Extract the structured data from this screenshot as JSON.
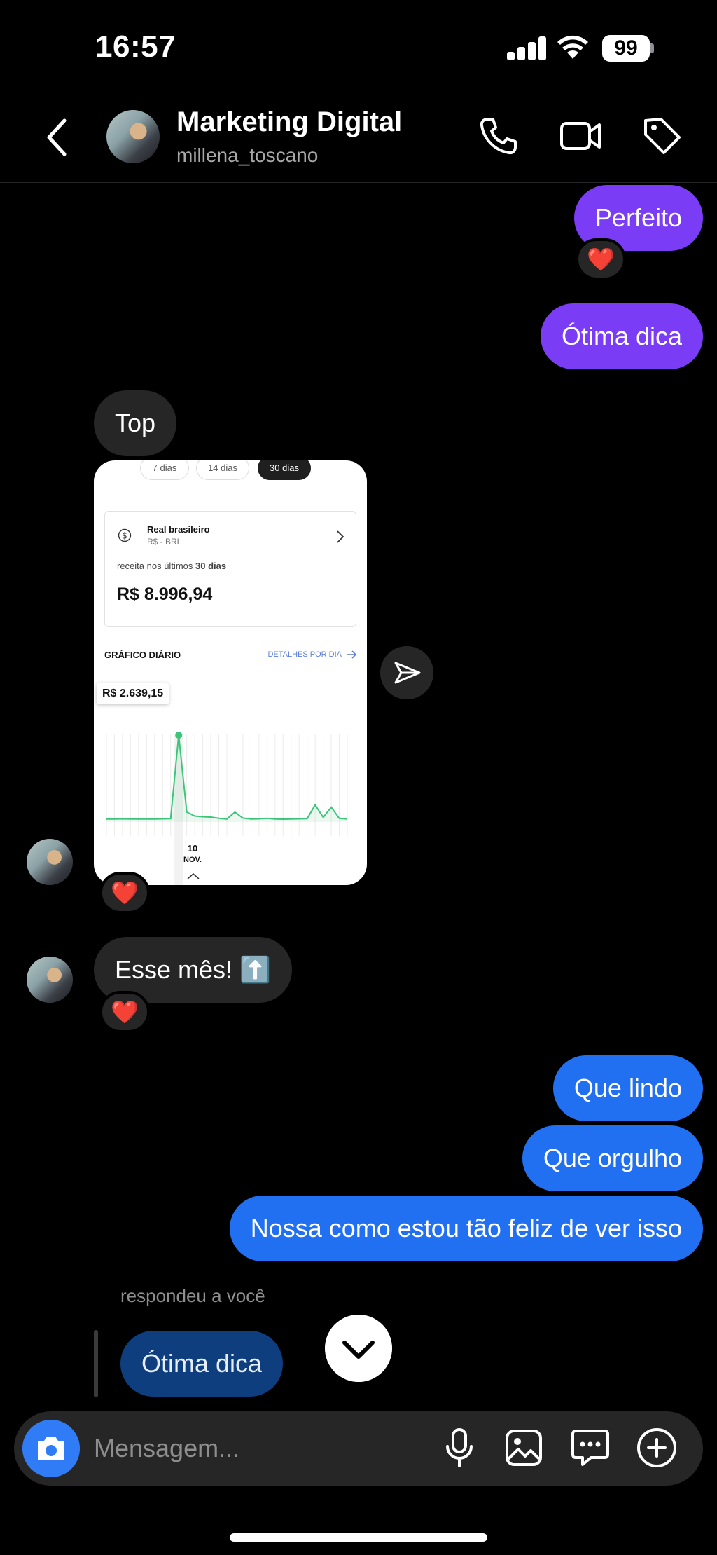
{
  "status": {
    "time": "16:57",
    "battery": "99"
  },
  "header": {
    "title": "Marketing Digital",
    "username": "millena_toscano"
  },
  "messages": {
    "perfeito": "Perfeito",
    "otima_dica": "Ótima dica",
    "top": "Top",
    "esse_mes": "Esse mês! ⬆️",
    "que_lindo": "Que lindo",
    "que_orgulho": "Que orgulho",
    "nossa": "Nossa como estou tão feliz de ver isso",
    "reaction": "❤️"
  },
  "shared_card": {
    "tabs": [
      "7 dias",
      "14 dias",
      "30 dias"
    ],
    "currency_name": "Real brasileiro",
    "currency_code": "R$ - BRL",
    "revenue_label_prefix": "receita nos últimos ",
    "revenue_label_bold": "30 dias",
    "revenue_value": "R$ 8.996,94",
    "chart_title": "GRÁFICO DIÁRIO",
    "details_link": "DETALHES POR DIA",
    "tooltip_value": "R$ 2.639,15",
    "date_day": "10",
    "date_month": "NOV."
  },
  "chart_data": {
    "type": "line",
    "title": "GRÁFICO DIÁRIO",
    "series": [
      {
        "values": [
          90,
          90,
          95,
          90,
          90,
          92,
          90,
          95,
          100,
          2639,
          300,
          180,
          160,
          150,
          110,
          90,
          300,
          120,
          90,
          95,
          110,
          90,
          85,
          90,
          95,
          100,
          520,
          140,
          450,
          110,
          90
        ]
      }
    ],
    "highlight": {
      "index": 9,
      "label": "R$ 2.639,15"
    },
    "colors": {
      "line": "#3cc47a"
    }
  },
  "reply": {
    "label": "respondeu a você",
    "quoted": "Ótima dica"
  },
  "composer": {
    "placeholder": "Mensagem..."
  }
}
